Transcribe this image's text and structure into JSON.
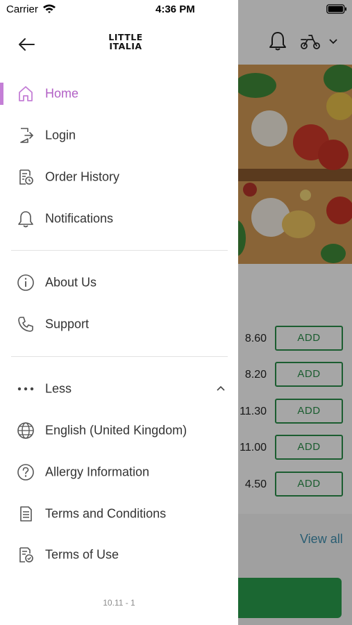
{
  "status_bar": {
    "carrier": "Carrier",
    "time": "4:36 PM"
  },
  "header": {
    "logo_line1": "LITTLE",
    "logo_line2": "ITALIA"
  },
  "menu": {
    "primary": [
      {
        "label": "Home",
        "icon": "home-icon",
        "active": true
      },
      {
        "label": "Login",
        "icon": "login-icon"
      },
      {
        "label": "Order History",
        "icon": "order-history-icon"
      },
      {
        "label": "Notifications",
        "icon": "bell-icon"
      }
    ],
    "secondary": [
      {
        "label": "About Us",
        "icon": "info-icon"
      },
      {
        "label": "Support",
        "icon": "phone-icon"
      }
    ],
    "more": [
      {
        "label": "Less",
        "icon": "more-dots-icon"
      },
      {
        "label": "English (United Kingdom)",
        "icon": "globe-icon"
      },
      {
        "label": "Allergy Information",
        "icon": "question-icon"
      },
      {
        "label": "Terms and Conditions",
        "icon": "document-icon"
      },
      {
        "label": "Terms of Use",
        "icon": "document-check-icon"
      }
    ]
  },
  "version": "10.11 - 1",
  "background": {
    "prices": [
      "8.60",
      "8.20",
      "11.30",
      "11.00",
      "4.50"
    ],
    "add_label": "ADD",
    "view_all": "View all"
  },
  "colors": {
    "accent": "#b15fc5",
    "active_bar": "#c47fd6",
    "add_green": "#2a8f4a",
    "cta_green": "#2a9f4e",
    "link_blue": "#3f8fb0"
  }
}
